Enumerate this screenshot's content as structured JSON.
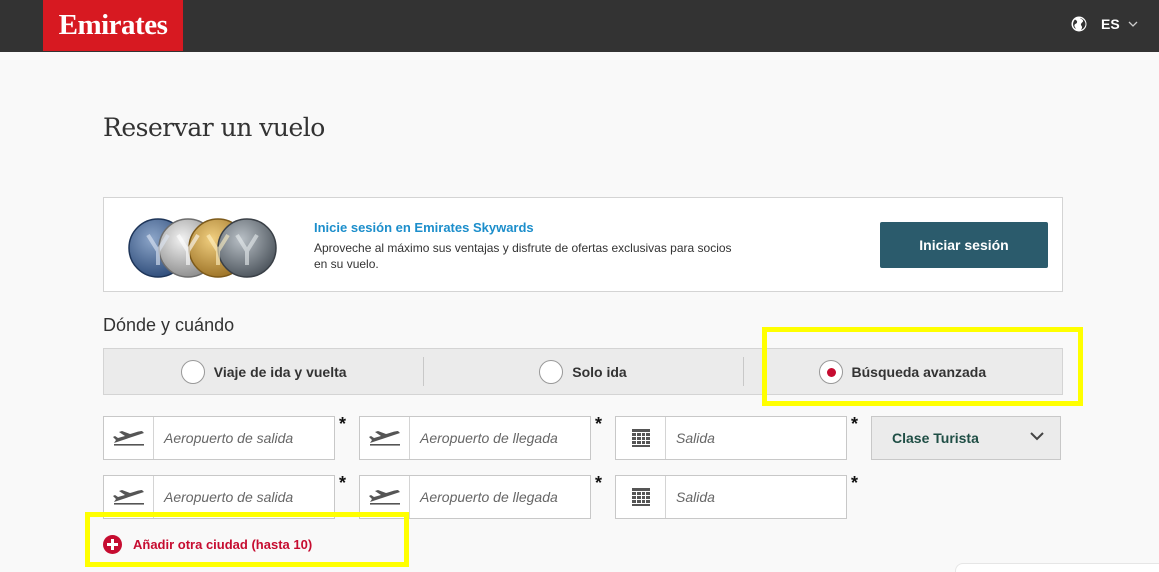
{
  "header": {
    "logo": "Emirates",
    "lang_code": "ES",
    "globe_icon": "globe-icon",
    "chevron_icon": "chevron-down-icon"
  },
  "page": {
    "title": "Reservar un vuelo"
  },
  "promo": {
    "title": "Inicie sesión en Emirates Skywards",
    "description": "Aproveche al máximo sus ventajas y disfrute de ofertas exclusivas para socios en su vuelo.",
    "login_label": "Iniciar sesión",
    "medals": [
      "bl",
      "si",
      "go",
      "platinum"
    ]
  },
  "search": {
    "section_title": "Dónde y cuándo",
    "trip_types": [
      {
        "label": "Viaje de ida y vuelta",
        "checked": false
      },
      {
        "label": "Solo ida",
        "checked": false
      },
      {
        "label": "Búsqueda avanzada",
        "checked": true
      }
    ],
    "segments": [
      {
        "from_placeholder": "Aeropuerto de salida",
        "to_placeholder": "Aeropuerto de llegada",
        "date_placeholder": "Salida",
        "required_mark": "*"
      },
      {
        "from_placeholder": "Aeropuerto de salida",
        "to_placeholder": "Aeropuerto de llegada",
        "date_placeholder": "Salida",
        "required_mark": "*"
      }
    ],
    "cabin_class": "Clase Turista",
    "add_city_label": "Añadir otra ciudad (hasta 10)"
  },
  "colors": {
    "brand_red": "#d71921",
    "login_button": "#2b5b6c",
    "link_blue": "#1c8ecb",
    "highlight": "#ffff00",
    "accent_red": "#c60c30"
  }
}
